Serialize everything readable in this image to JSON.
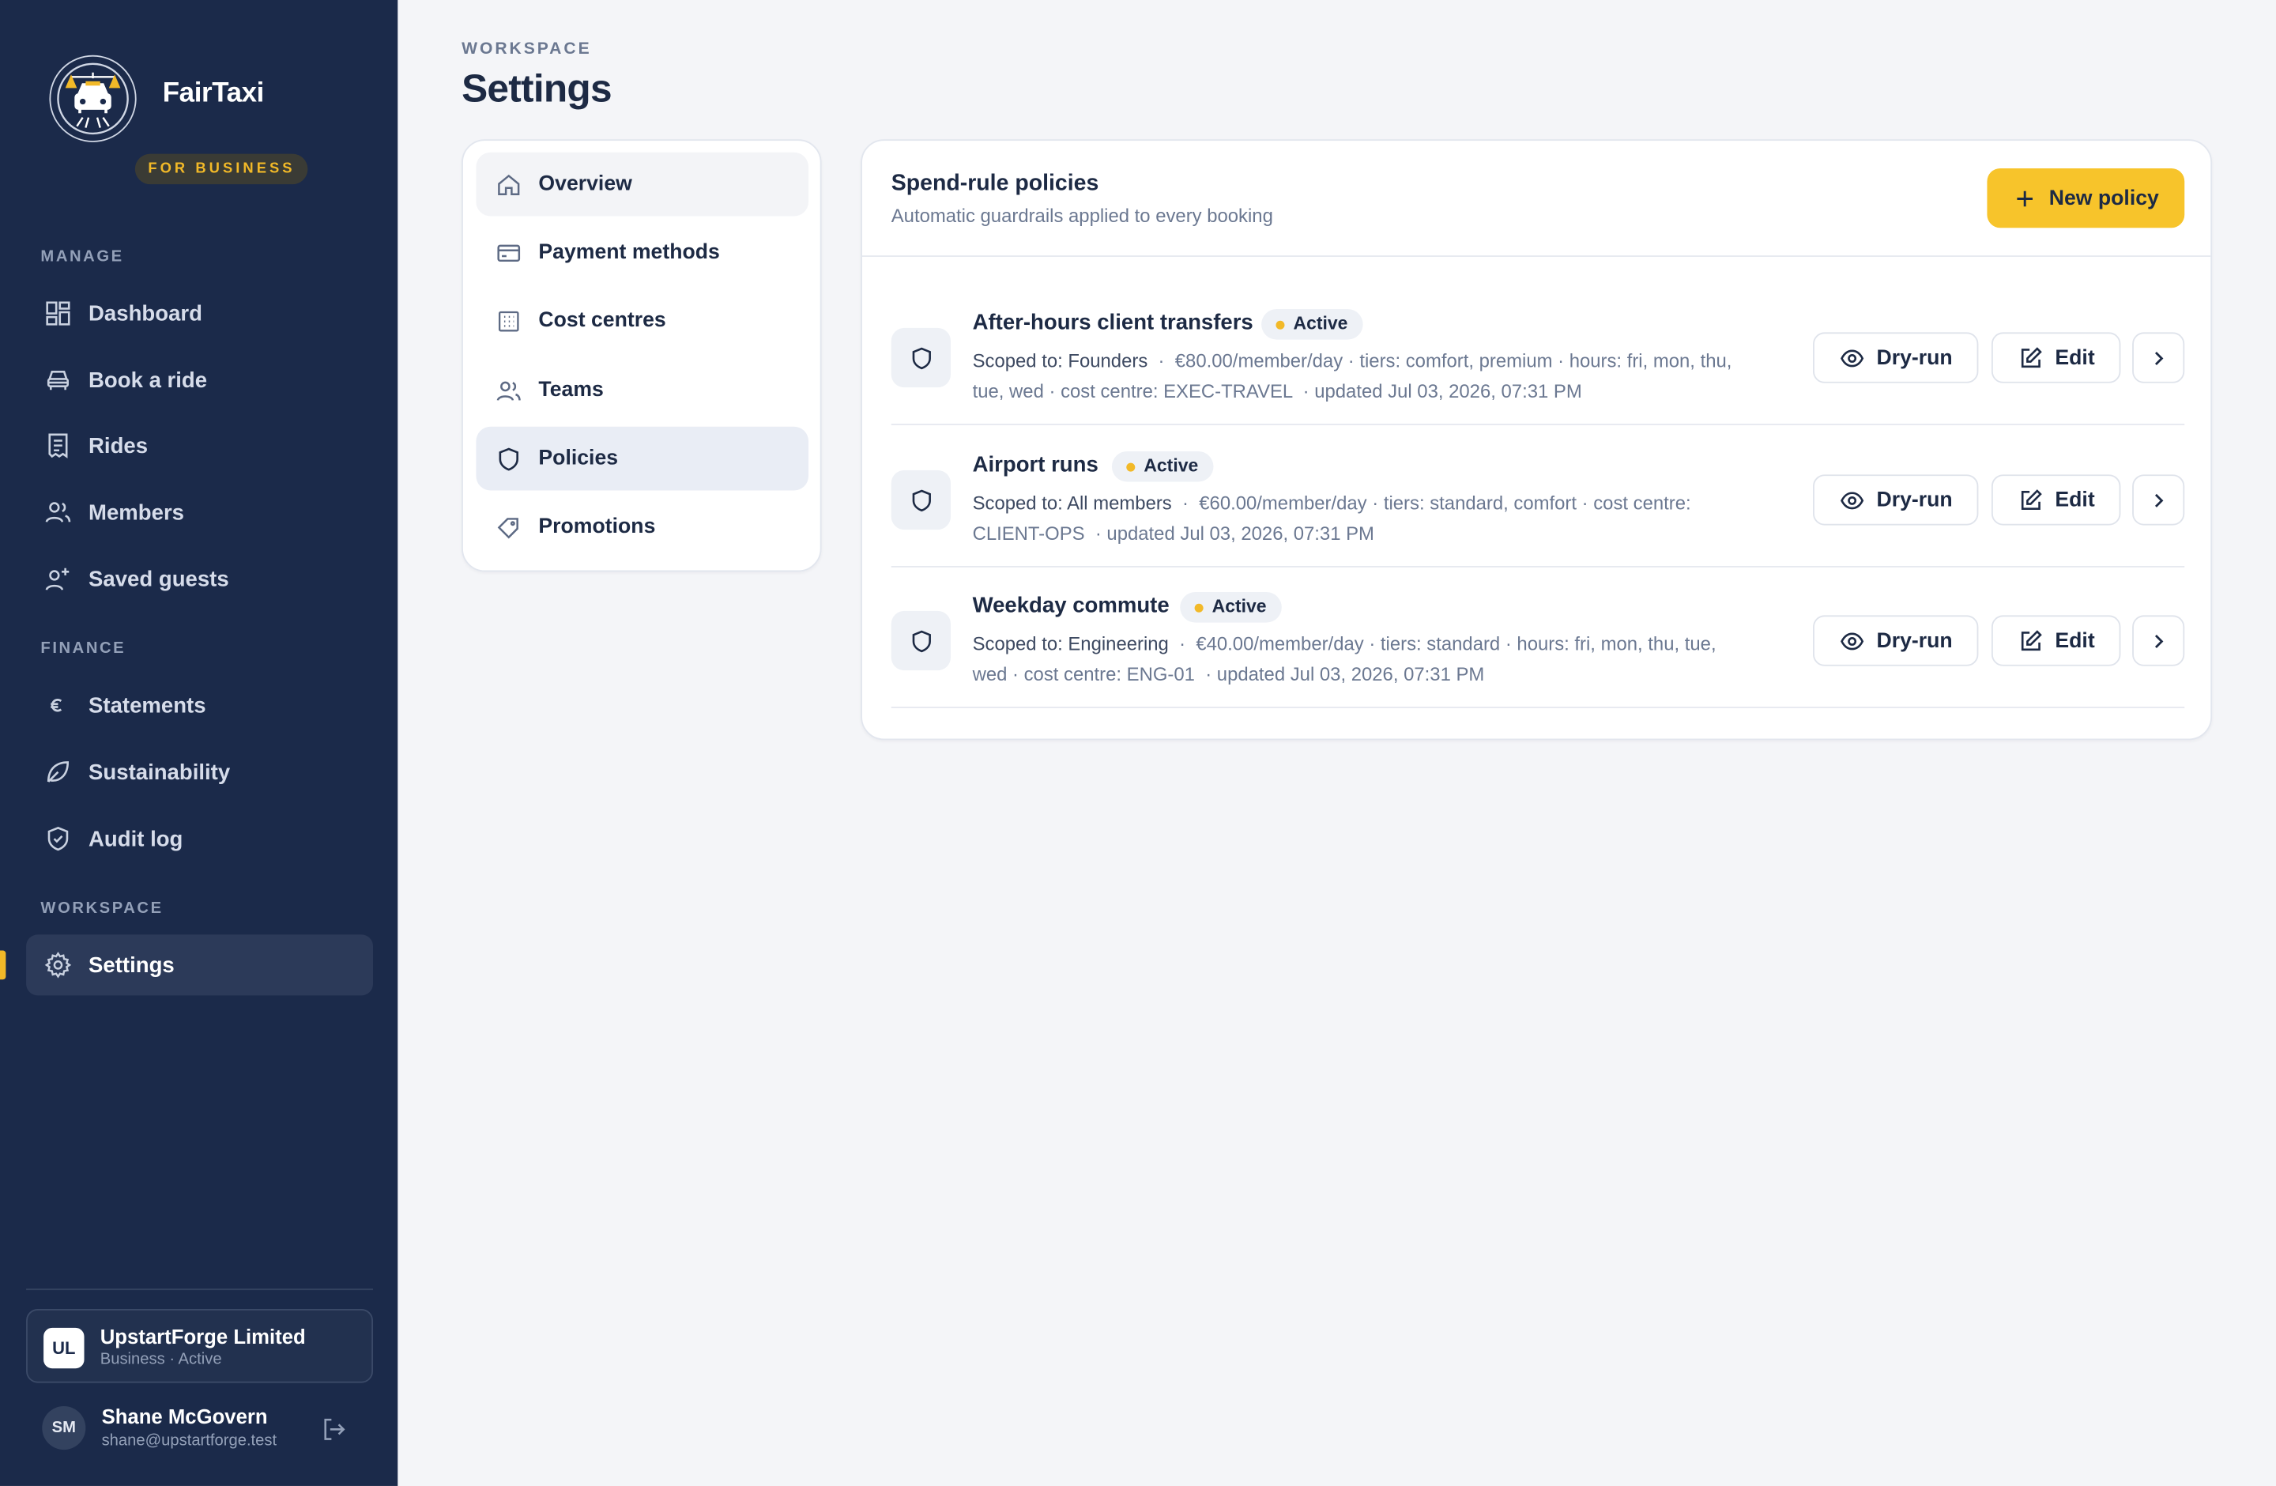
{
  "brand": {
    "name": "FairTaxi",
    "badge": "FOR BUSINESS"
  },
  "sidebar": {
    "sections": [
      {
        "label": "MANAGE",
        "items": [
          {
            "label": "Dashboard",
            "icon": "dashboard-icon"
          },
          {
            "label": "Book a ride",
            "icon": "car-icon"
          },
          {
            "label": "Rides",
            "icon": "receipt-icon"
          },
          {
            "label": "Members",
            "icon": "users-icon"
          },
          {
            "label": "Saved guests",
            "icon": "user-plus-icon"
          }
        ]
      },
      {
        "label": "FINANCE",
        "items": [
          {
            "label": "Statements",
            "icon": "euro-icon"
          },
          {
            "label": "Sustainability",
            "icon": "leaf-icon"
          },
          {
            "label": "Audit log",
            "icon": "shield-check-icon"
          }
        ]
      },
      {
        "label": "WORKSPACE",
        "items": [
          {
            "label": "Settings",
            "icon": "gear-icon",
            "active": true
          }
        ]
      }
    ],
    "org": {
      "initials": "UL",
      "name": "UpstartForge Limited",
      "sub": "Business · Active"
    },
    "user": {
      "initials": "SM",
      "name": "Shane McGovern",
      "email": "shane@upstartforge.test"
    }
  },
  "page": {
    "eyebrow": "WORKSPACE",
    "title": "Settings"
  },
  "subnav": {
    "items": [
      {
        "label": "Overview",
        "icon": "home-icon"
      },
      {
        "label": "Payment methods",
        "icon": "credit-card-icon"
      },
      {
        "label": "Cost centres",
        "icon": "building-icon"
      },
      {
        "label": "Teams",
        "icon": "users-icon"
      },
      {
        "label": "Policies",
        "icon": "shield-icon",
        "selected": true
      },
      {
        "label": "Promotions",
        "icon": "tag-icon"
      }
    ]
  },
  "policies": {
    "title": "Spend-rule policies",
    "subtitle": "Automatic guardrails applied to every booking",
    "new_button": "New policy",
    "dry_run_label": "Dry-run",
    "edit_label": "Edit",
    "items": [
      {
        "name": "After-hours client transfers",
        "status": "Active",
        "scope": "Scoped to: Founders",
        "meta_line1": "€80.00/member/day · tiers: comfort, premium · hours: fri, mon, thu,",
        "meta_line2": "tue, wed · cost centre: EXEC-TRAVEL",
        "updated": "· updated Jul 03, 2026, 07:31 PM"
      },
      {
        "name": "Airport runs",
        "status": "Active",
        "scope": "Scoped to: All members",
        "meta_line1": "€60.00/member/day · tiers: standard, comfort · cost centre:",
        "meta_line2": "CLIENT-OPS",
        "updated": "· updated Jul 03, 2026, 07:31 PM"
      },
      {
        "name": "Weekday commute",
        "status": "Active",
        "scope": "Scoped to: Engineering",
        "meta_line1": "€40.00/member/day · tiers: standard · hours: fri, mon, thu, tue,",
        "meta_line2": "wed · cost centre: ENG-01",
        "updated": "· updated Jul 03, 2026, 07:31 PM"
      }
    ]
  },
  "colors": {
    "sidebar": "#1b2a4a",
    "accent": "#f7c42b",
    "status_dot": "#f2b928"
  }
}
